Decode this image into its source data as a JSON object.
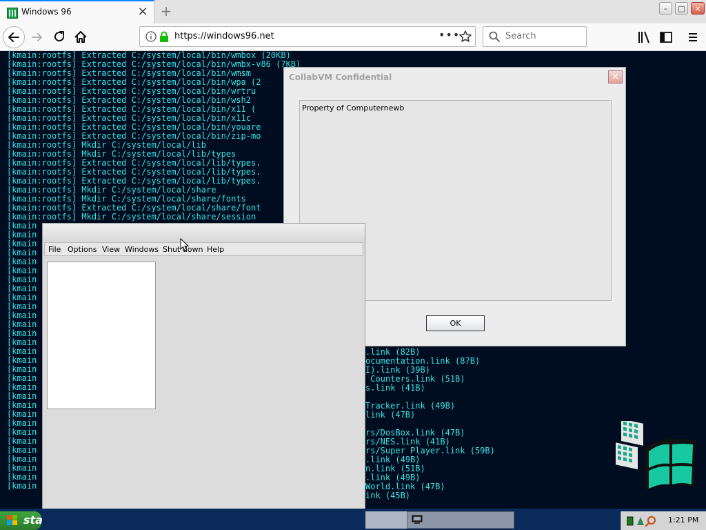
{
  "browser": {
    "tab_title": "Windows 96",
    "tab_close": "×",
    "new_tab": "+",
    "url": "https://windows96.net",
    "url_more": "•••",
    "search_placeholder": "Search",
    "window_controls": {
      "minimize": "–",
      "maximize": "□",
      "close": "×"
    }
  },
  "console": {
    "lines": [
      "[kmain:rootfs] Extracted C:/system/local/bin/wmbox (20KB)",
      "[kmain:rootfs] Extracted C:/system/local/bin/wmbx-v86 (7KB)",
      "[kmain:rootfs] Extracted C:/system/local/bin/wmsm",
      "[kmain:rootfs] Extracted C:/system/local/bin/wpa (2",
      "[kmain:rootfs] Extracted C:/system/local/bin/wrtru",
      "[kmain:rootfs] Extracted C:/system/local/bin/wsh2",
      "[kmain:rootfs] Extracted C:/system/local/bin/x11 (",
      "[kmain:rootfs] Extracted C:/system/local/bin/x11c",
      "[kmain:rootfs] Extracted C:/system/local/bin/youare",
      "[kmain:rootfs] Extracted C:/system/local/bin/zip-mo",
      "[kmain:rootfs] Mkdir C:/system/local/lib",
      "[kmain:rootfs] Mkdir C:/system/local/lib/types",
      "[kmain:rootfs] Extracted C:/system/local/lib/types.",
      "[kmain:rootfs] Extracted C:/system/local/lib/types.",
      "[kmain:rootfs] Extracted C:/system/local/lib/types.",
      "[kmain:rootfs] Mkdir C:/system/local/share",
      "[kmain:rootfs] Mkdir C:/system/local/share/fonts",
      "[kmain:rootfs] Extracted C:/system/local/share/font",
      "[kmain:rootfs] Mkdir C:/system/local/share/session",
      "[kmain",
      "[kmain",
      "[kmain",
      "[kmain",
      "[kmain",
      "[kmain",
      "[kmain",
      "[kmain",
      "[kmain",
      "[kmain",
      "[kmain",
      "[kmain",
      "[kmain",
      "[kmain",
      "[kmain",
      "[kmain",
      "[kmain",
      "[kmain",
      "[kmain",
      "[kmain",
      "[kmain",
      "[kmain",
      "[kmain",
      "[kmain",
      "[kmain",
      "[kmain",
      "[kmain",
      "[kmain",
      "[kmain",
      "[kmain"
    ],
    "right_lines": [
      ".link (82B)",
      "ocumentation.link (87B)",
      "I).link (39B)",
      " Counters.link (51B)",
      "s.link (41B)",
      "",
      "Tracker.link (49B)",
      "link (47B)",
      "",
      "rs/DosBox.link (47B)",
      "rs/NES.link (41B)",
      "rs/Super Player.link (59B)",
      ".link (49B)",
      "n.link (51B)",
      ".link (49B)",
      "World.link (47B)",
      "ink (45B)"
    ]
  },
  "dialog": {
    "title": "CollabVM Confidential",
    "message": "Property of Computernewb",
    "ok_label": "OK",
    "close_label": "×"
  },
  "file_manager": {
    "menu": [
      "File",
      "Options",
      "View",
      "Windows",
      "Shut down",
      "Help"
    ]
  },
  "taskbar": {
    "start_label": "sta",
    "clock": "1:21 PM"
  },
  "colors": {
    "console_text": "#37e4e4",
    "page_bg": "#000c20",
    "tab_accent": "#0a84ff"
  }
}
